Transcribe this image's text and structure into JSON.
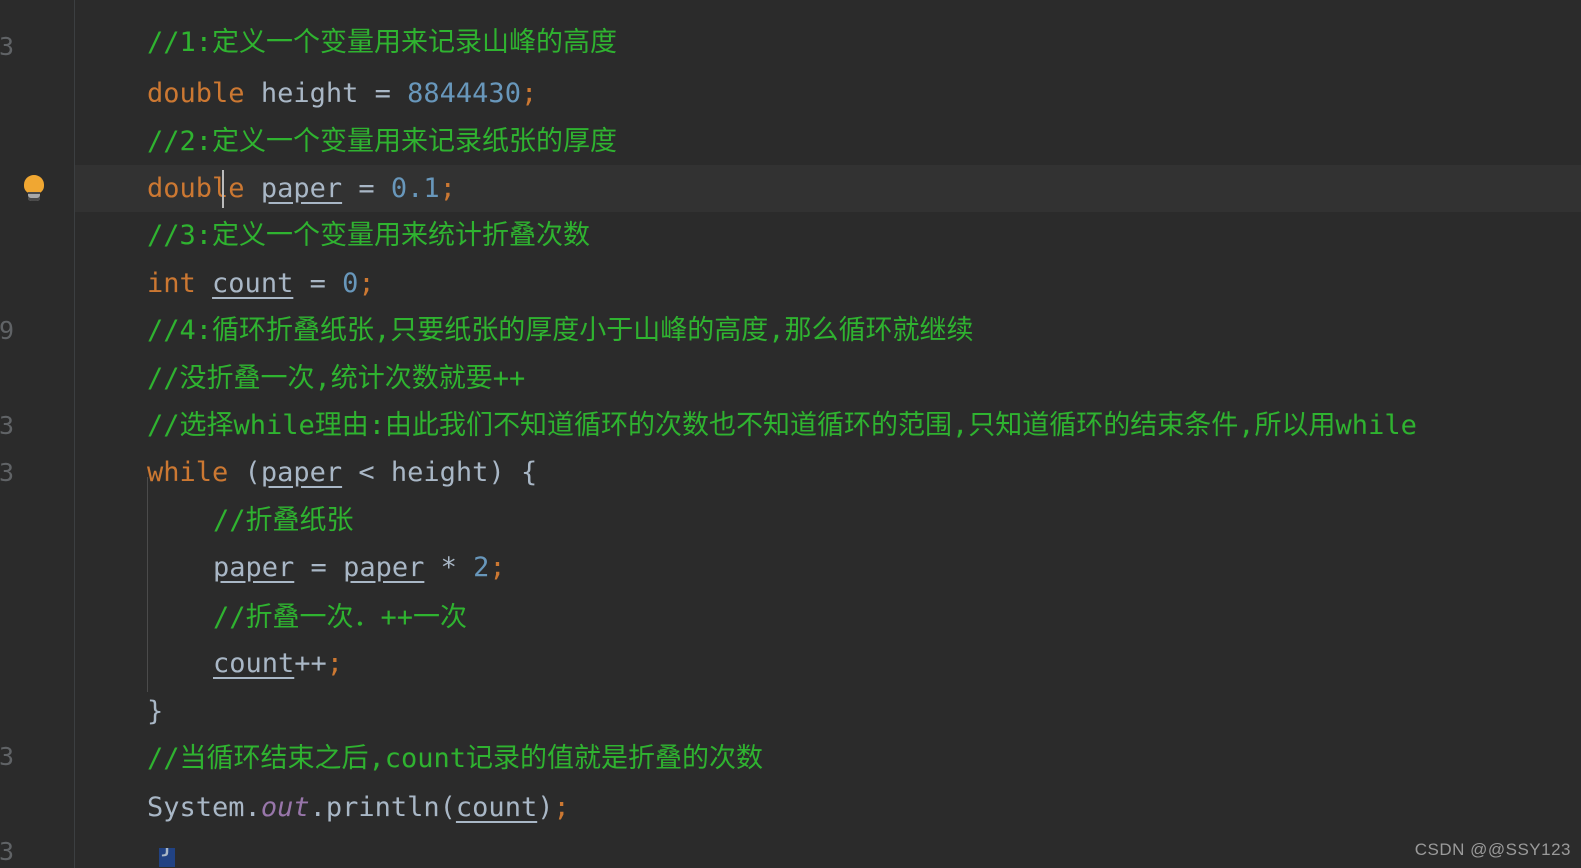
{
  "editor": {
    "background_color": "#2b2b2b",
    "current_line_color": "#323232",
    "gutter_border_color": "#3c3f41",
    "default_text_color": "#a9b7c6",
    "comment_color": "#2fb330",
    "keyword_color": "#cc7832",
    "number_color": "#6897bb",
    "static_field_color": "#9876aa",
    "caret_color": "#bbbbbb",
    "indent_guide_color": "#4b4b4b",
    "bulb_color": "#f0a732"
  },
  "gutter": {
    "bulb_icon": "lightbulb-icon",
    "bulb_tooltip": "Show Context Actions",
    "line_numbers": [
      "",
      "",
      "",
      "",
      "",
      "",
      "",
      "",
      "",
      "",
      "",
      "",
      "",
      "",
      "",
      "",
      "",
      ""
    ]
  },
  "code": {
    "language": "Java",
    "lines": [
      {
        "id": "line-comment-1",
        "indent": 0,
        "kind": "comment",
        "text": "//1:定义一个变量用来记录山峰的高度"
      },
      {
        "id": "line-decl-height",
        "indent": 0,
        "kind": "statement",
        "text": "double height = 8844430;",
        "tokens": {
          "keyword": "double",
          "name": "height",
          "operator": "=",
          "value": "8844430",
          "terminator": ";"
        }
      },
      {
        "id": "line-comment-2",
        "indent": 0,
        "kind": "comment",
        "text": "//2:定义一个变量用来记录纸张的厚度"
      },
      {
        "id": "line-decl-paper",
        "indent": 0,
        "kind": "statement",
        "current": true,
        "text": "double paper = 0.1;",
        "tokens": {
          "keyword": "double",
          "name": "paper",
          "operator": "=",
          "value": "0.1",
          "terminator": ";"
        }
      },
      {
        "id": "line-comment-3",
        "indent": 0,
        "kind": "comment",
        "text": "//3:定义一个变量用来统计折叠次数"
      },
      {
        "id": "line-decl-count",
        "indent": 0,
        "kind": "statement",
        "text": "int count = 0;",
        "tokens": {
          "keyword": "int",
          "name": "count",
          "operator": "=",
          "value": "0",
          "terminator": ";"
        }
      },
      {
        "id": "line-comment-4",
        "indent": 0,
        "kind": "comment",
        "text": "//4:循环折叠纸张,只要纸张的厚度小于山峰的高度,那么循环就继续"
      },
      {
        "id": "line-comment-5",
        "indent": 0,
        "kind": "comment",
        "text": "//没折叠一次,统计次数就要++"
      },
      {
        "id": "line-comment-6",
        "indent": 0,
        "kind": "comment",
        "text": "//选择while理由:由此我们不知道循环的次数也不知道循环的范围,只知道循环的结束条件,所以用while"
      },
      {
        "id": "line-while",
        "indent": 0,
        "kind": "statement",
        "text": "while (paper < height) {",
        "tokens": {
          "keyword": "while",
          "left": "paper",
          "operator": "<",
          "right": "height",
          "brace": "{"
        }
      },
      {
        "id": "line-comment-7",
        "indent": 1,
        "kind": "comment",
        "text": "//折叠纸张"
      },
      {
        "id": "line-paper-double",
        "indent": 1,
        "kind": "statement",
        "text": "paper = paper * 2;",
        "tokens": {
          "name": "paper",
          "operator": "=",
          "left": "paper",
          "mul": "*",
          "value": "2",
          "terminator": ";"
        }
      },
      {
        "id": "line-comment-8",
        "indent": 1,
        "kind": "comment",
        "text": "//折叠一次．++一次"
      },
      {
        "id": "line-count-inc",
        "indent": 1,
        "kind": "statement",
        "text": "count++;",
        "tokens": {
          "name": "count",
          "operator": "++",
          "terminator": ";"
        }
      },
      {
        "id": "line-close-brace",
        "indent": 0,
        "kind": "statement",
        "text": "}"
      },
      {
        "id": "line-comment-9",
        "indent": 0,
        "kind": "comment",
        "text": "//当循环结束之后,count记录的值就是折叠的次数"
      },
      {
        "id": "line-println",
        "indent": 0,
        "kind": "statement",
        "text": "System.out.println(count);",
        "tokens": {
          "cls": "System",
          "field": "out",
          "method": "println",
          "arg": "count",
          "terminator": ";"
        }
      }
    ],
    "bottom_partial_brace": "}"
  },
  "watermark": {
    "text": "CSDN @@SSY123"
  }
}
